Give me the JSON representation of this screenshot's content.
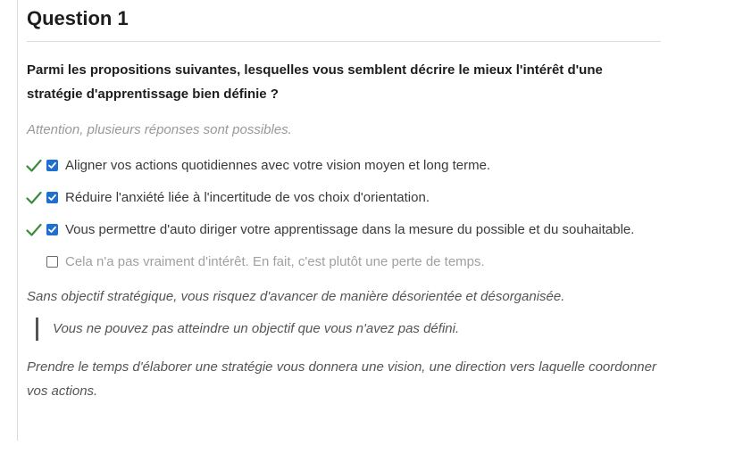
{
  "question": {
    "title": "Question 1",
    "text": "Parmi les propositions suivantes, lesquelles vous semblent décrire le mieux l'intérêt d'une stratégie d'apprentissage bien définie ?",
    "hint": "Attention, plusieurs réponses sont possibles."
  },
  "options": [
    {
      "label": "Aligner vos actions quotidiennes avec votre vision moyen et long terme.",
      "checked": true,
      "correct": true
    },
    {
      "label": "Réduire l'anxiété liée à l'incertitude de vos choix d'orientation.",
      "checked": true,
      "correct": true
    },
    {
      "label": "Vous permettre d'auto diriger votre  apprentissage dans la mesure du possible et du souhaitable.",
      "checked": true,
      "correct": true
    },
    {
      "label": "Cela n'a pas vraiment d'intérêt. En fait, c'est plutôt une perte de temps.",
      "checked": false,
      "correct": false
    }
  ],
  "feedback": {
    "line1": "Sans objectif stratégique, vous risquez d'avancer de manière désorientée et désorganisée.",
    "quote": "Vous ne pouvez pas atteindre un objectif que vous n'avez pas défini.",
    "line2": "Prendre le temps d'élaborer une stratégie vous donnera une vision, une direction vers laquelle coordonner vos actions."
  },
  "colors": {
    "correct_check": "#3c8a3c",
    "checkbox_checked": "#1f6fd1"
  }
}
